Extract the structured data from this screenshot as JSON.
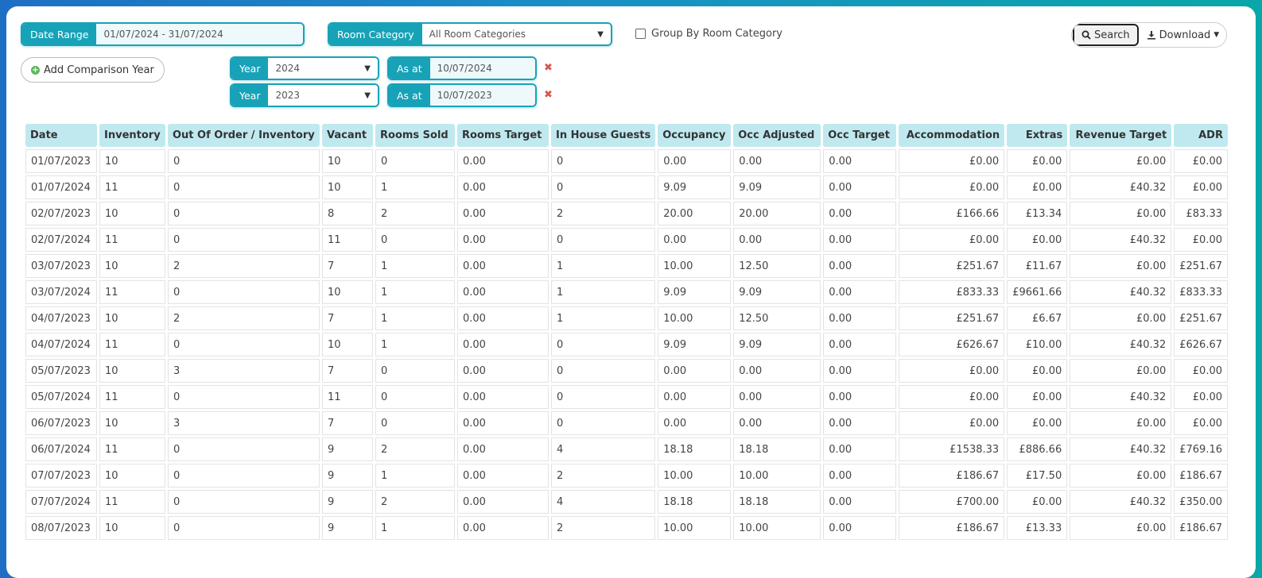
{
  "filters": {
    "date_range_label": "Date Range",
    "date_range_value": "01/07/2024 - 31/07/2024",
    "room_category_label": "Room Category",
    "room_category_value": "All Room Categories",
    "group_by_label": "Group By Room Category",
    "add_comparison_label": "Add Comparison Year",
    "search_label": "Search",
    "download_label": "Download",
    "years": [
      {
        "year_label": "Year",
        "year_value": "2024",
        "as_at_label": "As at",
        "as_at_value": "10/07/2024"
      },
      {
        "year_label": "Year",
        "year_value": "2023",
        "as_at_label": "As at",
        "as_at_value": "10/07/2023"
      }
    ]
  },
  "table": {
    "columns": [
      "Date",
      "Inventory",
      "Out Of Order / Inventory",
      "Vacant",
      "Rooms Sold",
      "Rooms Target",
      "In House Guests",
      "Occupancy",
      "Occ Adjusted",
      "Occ Target",
      "Accommodation",
      "Extras",
      "Revenue Target",
      "ADR"
    ],
    "rows": [
      [
        "01/07/2023",
        "10",
        "0",
        "10",
        "0",
        "0.00",
        "0",
        "0.00",
        "0.00",
        "0.00",
        "£0.00",
        "£0.00",
        "£0.00",
        "£0.00"
      ],
      [
        "01/07/2024",
        "11",
        "0",
        "10",
        "1",
        "0.00",
        "0",
        "9.09",
        "9.09",
        "0.00",
        "£0.00",
        "£0.00",
        "£40.32",
        "£0.00"
      ],
      [
        "02/07/2023",
        "10",
        "0",
        "8",
        "2",
        "0.00",
        "2",
        "20.00",
        "20.00",
        "0.00",
        "£166.66",
        "£13.34",
        "£0.00",
        "£83.33"
      ],
      [
        "02/07/2024",
        "11",
        "0",
        "11",
        "0",
        "0.00",
        "0",
        "0.00",
        "0.00",
        "0.00",
        "£0.00",
        "£0.00",
        "£40.32",
        "£0.00"
      ],
      [
        "03/07/2023",
        "10",
        "2",
        "7",
        "1",
        "0.00",
        "1",
        "10.00",
        "12.50",
        "0.00",
        "£251.67",
        "£11.67",
        "£0.00",
        "£251.67"
      ],
      [
        "03/07/2024",
        "11",
        "0",
        "10",
        "1",
        "0.00",
        "1",
        "9.09",
        "9.09",
        "0.00",
        "£833.33",
        "£9661.66",
        "£40.32",
        "£833.33"
      ],
      [
        "04/07/2023",
        "10",
        "2",
        "7",
        "1",
        "0.00",
        "1",
        "10.00",
        "12.50",
        "0.00",
        "£251.67",
        "£6.67",
        "£0.00",
        "£251.67"
      ],
      [
        "04/07/2024",
        "11",
        "0",
        "10",
        "1",
        "0.00",
        "0",
        "9.09",
        "9.09",
        "0.00",
        "£626.67",
        "£10.00",
        "£40.32",
        "£626.67"
      ],
      [
        "05/07/2023",
        "10",
        "3",
        "7",
        "0",
        "0.00",
        "0",
        "0.00",
        "0.00",
        "0.00",
        "£0.00",
        "£0.00",
        "£0.00",
        "£0.00"
      ],
      [
        "05/07/2024",
        "11",
        "0",
        "11",
        "0",
        "0.00",
        "0",
        "0.00",
        "0.00",
        "0.00",
        "£0.00",
        "£0.00",
        "£40.32",
        "£0.00"
      ],
      [
        "06/07/2023",
        "10",
        "3",
        "7",
        "0",
        "0.00",
        "0",
        "0.00",
        "0.00",
        "0.00",
        "£0.00",
        "£0.00",
        "£0.00",
        "£0.00"
      ],
      [
        "06/07/2024",
        "11",
        "0",
        "9",
        "2",
        "0.00",
        "4",
        "18.18",
        "18.18",
        "0.00",
        "£1538.33",
        "£886.66",
        "£40.32",
        "£769.16"
      ],
      [
        "07/07/2023",
        "10",
        "0",
        "9",
        "1",
        "0.00",
        "2",
        "10.00",
        "10.00",
        "0.00",
        "£186.67",
        "£17.50",
        "£0.00",
        "£186.67"
      ],
      [
        "07/07/2024",
        "11",
        "0",
        "9",
        "2",
        "0.00",
        "4",
        "18.18",
        "18.18",
        "0.00",
        "£700.00",
        "£0.00",
        "£40.32",
        "£350.00"
      ],
      [
        "08/07/2023",
        "10",
        "0",
        "9",
        "1",
        "0.00",
        "2",
        "10.00",
        "10.00",
        "0.00",
        "£186.67",
        "£13.33",
        "£0.00",
        "£186.67"
      ]
    ]
  }
}
